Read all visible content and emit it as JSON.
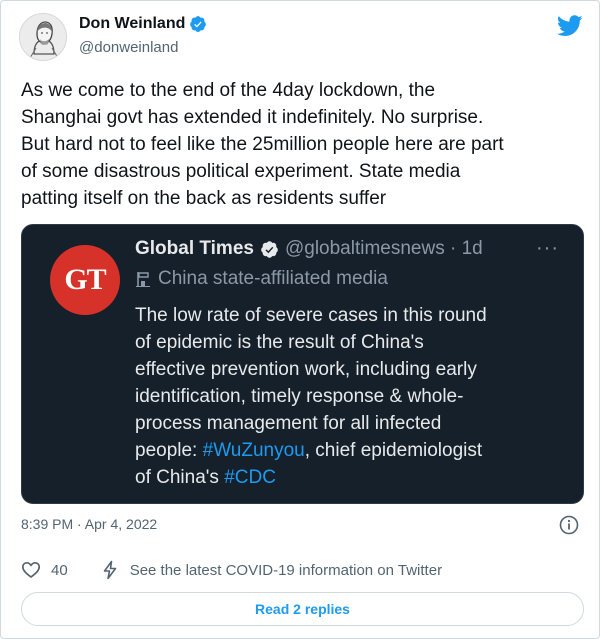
{
  "tweet": {
    "author": {
      "name": "Don Weinland",
      "handle": "@donweinland"
    },
    "text_lines": [
      "As we come to the end of the 4day lockdown, the",
      "Shanghai govt has extended it indefinitely. No surprise.",
      "But hard not to feel like the 25million people here are part",
      "of some disastrous political experiment. State media",
      "patting itself on the back as residents suffer"
    ],
    "quoted": {
      "logo_text": "GT",
      "name": "Global Times",
      "handle_time": "@globaltimesnews · 1d",
      "more": "···",
      "label": "China state-affiliated media",
      "line1": "The low rate of severe cases in this round",
      "line2": "of epidemic is the result of China's",
      "line3": "effective prevention work, including early",
      "line4": "identification, timely response & whole-",
      "line5": "process management for all infected",
      "line6_prefix": "people: ",
      "line6_hashtag": "#WuZunyou",
      "line6_suffix": ", chief epidemiologist",
      "line7_prefix": "of China's ",
      "line7_hashtag": "#CDC"
    },
    "timestamp": "8:39 PM · Apr 4, 2022",
    "likes": "40",
    "covid_link": "See the latest COVID-19 information on Twitter",
    "replies_button": "Read 2 replies"
  },
  "colors": {
    "twitter_blue": "#1d9bf0",
    "quote_background": "#16202b",
    "global_times_red": "#d7322a"
  },
  "icons": [
    "avatar-sketch",
    "verified-badge-icon",
    "twitter-bird-icon",
    "info-icon",
    "heart-icon",
    "lightning-icon",
    "media-label-icon",
    "more-dots-icon"
  ]
}
